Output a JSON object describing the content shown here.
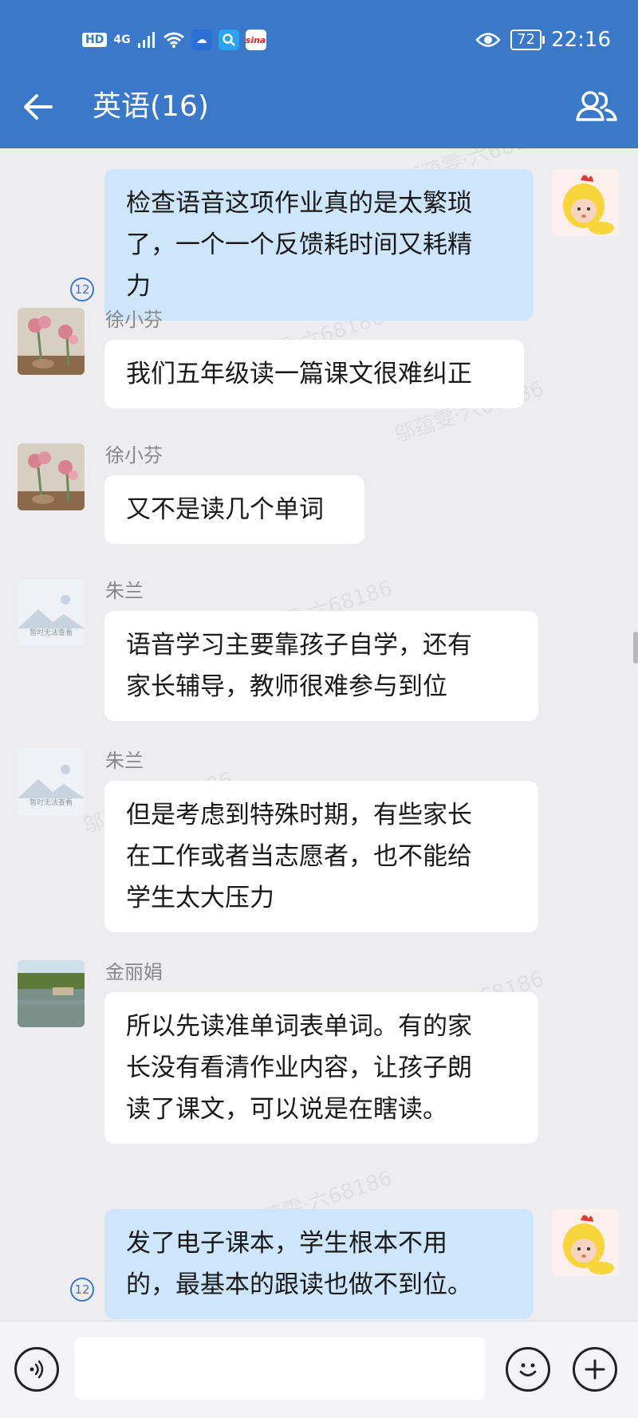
{
  "status_bar": {
    "hd": "HD",
    "network": "4G",
    "battery": "72",
    "time": "22:16",
    "app_label": "sina"
  },
  "header": {
    "title": "英语(16)"
  },
  "watermark": "邬蕴雯·六68186",
  "messages": [
    {
      "side": "out",
      "read_count": "12",
      "lines": [
        "检查语音这项作业真的是太繁琐",
        "了，一个一个反馈耗时间又耗精",
        "力"
      ]
    },
    {
      "side": "in",
      "sender": "徐小芬",
      "lines": [
        "我们五年级读一篇课文很难纠正"
      ]
    },
    {
      "side": "in",
      "sender": "徐小芬",
      "lines": [
        "又不是读几个单词"
      ]
    },
    {
      "side": "in",
      "sender": "朱兰",
      "avatar_placeholder": "暂时无法查看",
      "lines": [
        "语音学习主要靠孩子自学，还有",
        "家长辅导，教师很难参与到位"
      ]
    },
    {
      "side": "in",
      "sender": "朱兰",
      "avatar_placeholder": "暂时无法查看",
      "lines": [
        "但是考虑到特殊时期，有些家长",
        "在工作或者当志愿者，也不能给",
        "学生太大压力"
      ]
    },
    {
      "side": "in",
      "sender": "金丽娟",
      "lines": [
        "所以先读准单词表单词。有的家",
        "长没有看清作业内容，让孩子朗",
        "读了课文，可以说是在瞎读。"
      ]
    },
    {
      "side": "out",
      "read_count": "12",
      "lines": [
        "发了电子课本，学生根本不用",
        "的，最基本的跟读也做不到位。"
      ]
    }
  ],
  "footer": {
    "input_value": ""
  },
  "colors": {
    "header_bg": "#3a78c9",
    "chat_bg": "#ededf0",
    "outgoing_bubble": "#cde6fb",
    "incoming_bubble": "#ffffff"
  },
  "icons": {
    "back": "arrow-left-icon",
    "members": "group-members-icon",
    "voice": "voice-icon",
    "emoji": "emoji-icon",
    "add": "plus-icon"
  }
}
